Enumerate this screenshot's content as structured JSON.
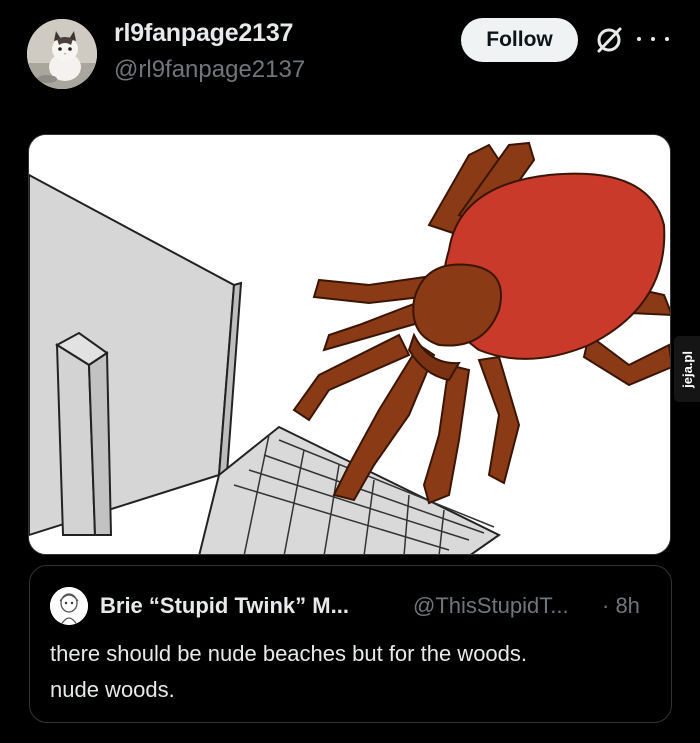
{
  "post": {
    "author": {
      "display_name": "rl9fanpage2137",
      "handle": "@rl9fanpage2137",
      "avatar_icon": "cat-avatar"
    },
    "follow_label": "Follow",
    "grok_icon": "grok-icon",
    "more_icon": "more-options-icon",
    "media": {
      "description_icon": "spider-at-computer-drawing",
      "watermark": "jeja.pl"
    }
  },
  "quote": {
    "display_name": "Brie “Stupid Twink” M...",
    "handle": "@ThisStupidT...",
    "time": "· 8h",
    "text": "there should be nude beaches but for the woods.\nnude woods.",
    "avatar_icon": "sketch-avatar"
  },
  "colors": {
    "background": "#000000",
    "text_primary": "#e7e9ea",
    "text_secondary": "#71767b",
    "button_bg": "#eff3f4",
    "border": "#2f3336",
    "spider_body": "#c93a2a",
    "spider_legs": "#8b3a16"
  }
}
